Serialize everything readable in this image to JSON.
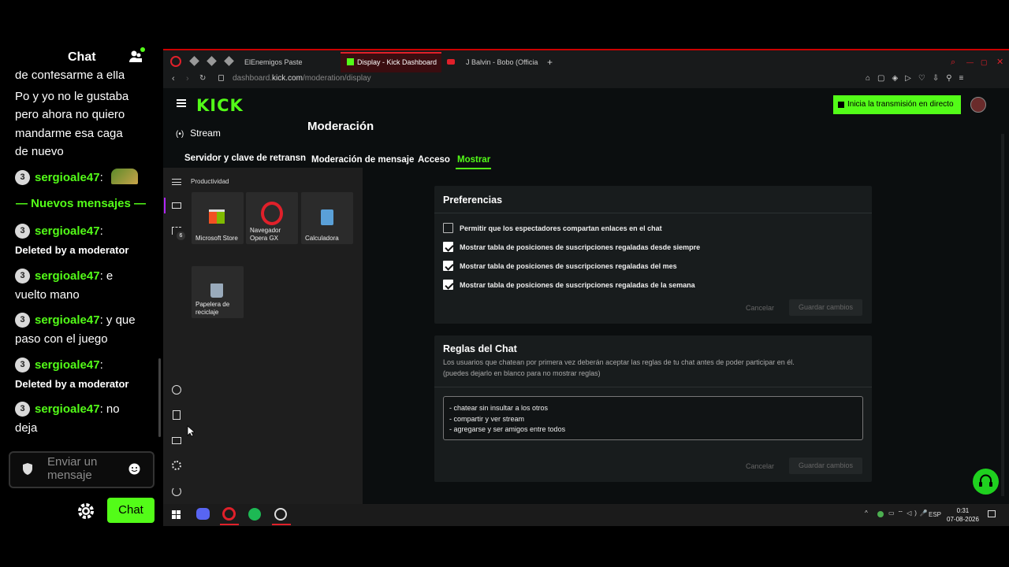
{
  "chat": {
    "title": "Chat",
    "messages": [
      {
        "text": "de confesarme a ella"
      },
      {
        "text": "Po y yo no le gustaba"
      },
      {
        "text": "pero ahora no quiero"
      },
      {
        "text": "mandarme esa caga"
      },
      {
        "text": "de nuevo"
      }
    ],
    "badge": "3",
    "user": "sergioale47",
    "new_messages": "Nuevos mensajes",
    "deleted": "Deleted by a moderator",
    "msg1": ": e",
    "msg1b": "vuelto mano",
    "msg2": ": y que",
    "msg2b": "paso con el juego",
    "msg3": ": no",
    "msg3b": "deja",
    "input_placeholder": "Enviar un mensaje",
    "send_button": "Chat",
    "colon": ":"
  },
  "browser": {
    "tabs": [
      {
        "label": "ElEnemigos Paste"
      },
      {
        "label": "Display - Kick Dashboard"
      },
      {
        "label": "J Balvin - Bobo (Officia"
      }
    ],
    "url_prefix": "dashboard.",
    "url_domain": "kick.com",
    "url_path": "/moderation/display"
  },
  "kick": {
    "logo": "KICK",
    "go_live": "Inicia la transmisión en directo",
    "stream_label": "Stream",
    "page_title": "Moderación",
    "subtabs": [
      "Servidor y clave de retransn",
      "Moderación de mensaje",
      "Acceso",
      "Mostrar"
    ],
    "preferences": {
      "title": "Preferencias",
      "options": [
        {
          "label": "Permitir que los espectadores compartan enlaces en el chat",
          "checked": false
        },
        {
          "label": "Mostrar tabla de posiciones de suscripciones regaladas desde siempre",
          "checked": true
        },
        {
          "label": "Mostrar tabla de posiciones de suscripciones regaladas del mes",
          "checked": true
        },
        {
          "label": "Mostrar tabla de posiciones de suscripciones regaladas de la semana",
          "checked": true
        }
      ],
      "cancel": "Cancelar",
      "save": "Guardar cambios"
    },
    "rules": {
      "title": "Reglas del Chat",
      "desc1": "Los usuarios que chatean por primera vez deberán aceptar las reglas de tu chat antes de poder participar en él.",
      "desc2": "(puedes dejarlo en blanco para no mostrar reglas)",
      "text": "- chatear sin insultar a los otros\n- compartir y ver stream\n- agregarse y ser amigos entre todos",
      "cancel": "Cancelar",
      "save": "Guardar cambios"
    }
  },
  "startmenu": {
    "heading": "Productividad",
    "badge": "6",
    "tiles": [
      {
        "label": "Microsoft Store"
      },
      {
        "label": "Navegador Opera GX"
      },
      {
        "label": "Calculadora"
      },
      {
        "label": "Papelera de reciclaje"
      }
    ]
  },
  "taskbar": {
    "lang": "ESP",
    "time": "0:31",
    "date": "07-08-2026"
  },
  "colors": {
    "accent": "#53fc18",
    "opera": "#e0202a"
  }
}
